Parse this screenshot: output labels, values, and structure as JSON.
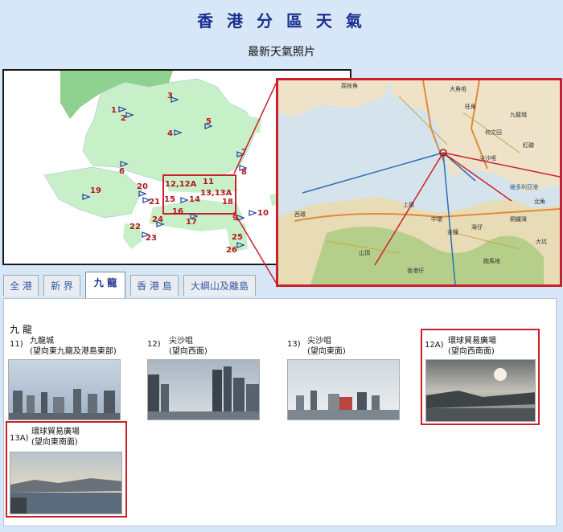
{
  "page": {
    "title": "香 港 分 區 天 氣",
    "subtitle": "最新天氣照片"
  },
  "map": {
    "labels": [
      "1",
      "2",
      "3",
      "4",
      "5",
      "6",
      "7",
      "8",
      "9",
      "10",
      "11",
      "12,12A",
      "13,13A",
      "14",
      "15",
      "16",
      "17",
      "18",
      "19",
      "20",
      "21",
      "22",
      "23",
      "24",
      "25",
      "26"
    ],
    "zoom_labels": [
      "荔枝角",
      "大角咀",
      "旺角",
      "九龍城",
      "何文田",
      "紅磡",
      "尖沙咀",
      "維多利亞港",
      "上環",
      "西環",
      "中環",
      "金鐘",
      "灣仔",
      "銅鑼灣",
      "山頂",
      "北角",
      "大坑",
      "跑馬地",
      "香港仔"
    ]
  },
  "tabs": [
    {
      "label": "全 港",
      "active": false
    },
    {
      "label": "新 界",
      "active": false
    },
    {
      "label": "九 龍",
      "active": true
    },
    {
      "label": "香 港 島",
      "active": false
    },
    {
      "label": "大嶼山及離島",
      "active": false
    }
  ],
  "section_title": "九 龍",
  "cards": [
    {
      "num": "11)",
      "name": "九龍城",
      "dir": "(望向東九龍及港島東部)"
    },
    {
      "num": "12)",
      "name": "尖沙咀",
      "dir": "(望向西面)"
    },
    {
      "num": "13)",
      "name": "尖沙咀",
      "dir": "(望向東面)"
    },
    {
      "num": "12A)",
      "name": "環球貿易廣場",
      "dir": "(望向西南面)"
    },
    {
      "num": "13A)",
      "name": "環球貿易廣場",
      "dir": "(望向東南面)"
    }
  ],
  "colors": {
    "accent": "#1b2f8f",
    "highlight": "#cc1f2b",
    "land": "#c8f0c8",
    "sea": "#ffffff"
  }
}
